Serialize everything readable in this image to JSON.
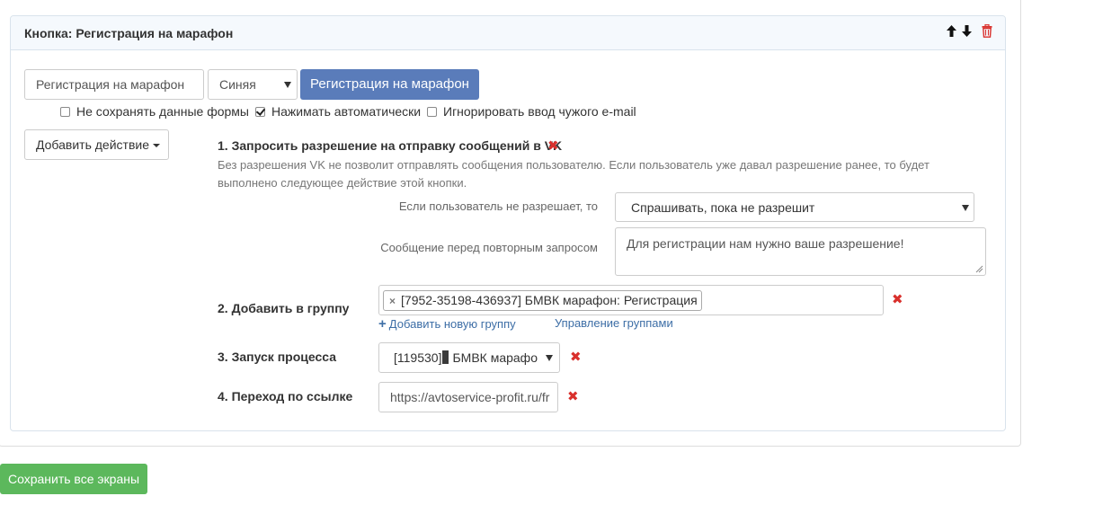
{
  "panel": {
    "title": "Кнопка: Регистрация на марафон",
    "icons": [
      "arrow-up-icon",
      "arrow-down-icon",
      "trash-icon"
    ]
  },
  "button_config": {
    "name_value": "Регистрация на марафон",
    "color_value": "Синяя",
    "preview_label": "Регистрация на марафон",
    "accent_color": "#5a7cba"
  },
  "options": [
    {
      "label": "Не сохранять данные формы",
      "checked": false
    },
    {
      "label": "Нажимать автоматически",
      "checked": true
    },
    {
      "label": "Игнорировать ввод чужого e-mail",
      "checked": false
    }
  ],
  "add_action_label": "Добавить действие",
  "steps": {
    "vk": {
      "title": "1. Запросить разрешение на отправку сообщений в VK",
      "description": "Без разрешения VK не позволит отправлять сообщения пользователю. Если пользователь уже давал разрешение ранее, то будет выполнено следующее действие этой кнопки.",
      "deny_label": "Если пользователь не разрешает, то",
      "deny_value": "Спрашивать, пока не разрешит",
      "message_label": "Сообщение перед повторным запросом",
      "message_value": "Для регистрации нам нужно ваше разрешение!"
    },
    "group": {
      "title": "2. Добавить в группу",
      "tag": "[7952-35198-436937] БМВК марафон: Регистрация",
      "add_group_link": "Добавить новую группу",
      "manage_link": "Управление группами"
    },
    "process": {
      "title": "3. Запуск процесса",
      "value_prefix": "[119530]",
      "value_suffix": "БМВК марафо"
    },
    "link": {
      "title": "4. Переход по ссылке",
      "value": "https://avtoservice-profit.ru/fr"
    }
  },
  "save_all_label": "Сохранить все экраны",
  "colors": {
    "delete_red": "#d9302c",
    "save_green": "#5cb85c",
    "link_blue": "#3d6ea6"
  }
}
